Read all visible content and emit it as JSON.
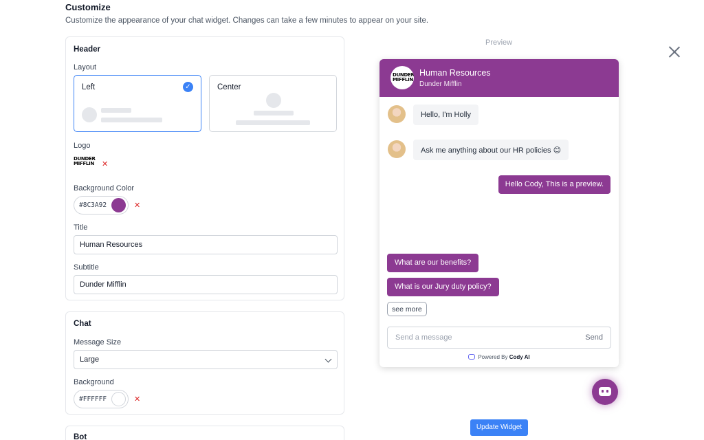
{
  "page": {
    "title": "Customize",
    "subtitle": "Customize the appearance of your chat widget. Changes can take a few minutes to appear on your site."
  },
  "header_section": {
    "title": "Header",
    "layout_label": "Layout",
    "layout_options": [
      {
        "label": "Left",
        "selected": true
      },
      {
        "label": "Center",
        "selected": false
      }
    ],
    "logo_label": "Logo",
    "logo_text_line1": "DUNDER",
    "logo_text_line2": "MIFFLIN",
    "background_color_label": "Background Color",
    "background_color_value": "#8C3A92",
    "title_label": "Title",
    "title_value": "Human Resources",
    "subtitle_label": "Subtitle",
    "subtitle_value": "Dunder Mifflin"
  },
  "chat_section": {
    "title": "Chat",
    "message_size_label": "Message Size",
    "message_size_value": "Large",
    "background_label": "Background",
    "background_value": "#FFFFFF"
  },
  "bot_section": {
    "title": "Bot"
  },
  "preview": {
    "label": "Preview",
    "header_title": "Human Resources",
    "header_subtitle": "Dunder Mifflin",
    "bot_messages": [
      "Hello, I'm Holly",
      "Ask me anything about our HR policies 😊"
    ],
    "user_message": "Hello Cody, This is a preview.",
    "suggestions": [
      "What are our benefits?",
      "What is our Jury duty policy?"
    ],
    "see_more": "see more",
    "input_placeholder": "Send a message",
    "send_label": "Send",
    "powered_by_prefix": "Powered By",
    "powered_by_brand": "Cody AI"
  },
  "actions": {
    "update_button": "Update Widget"
  },
  "colors": {
    "accent": "#8C3A92",
    "primary_button": "#3b82f6"
  },
  "icons": {
    "close": "close-icon",
    "check": "check-icon",
    "remove": "remove-x-icon",
    "chevron": "chevron-down-icon",
    "launcher": "bot-launcher-icon"
  }
}
